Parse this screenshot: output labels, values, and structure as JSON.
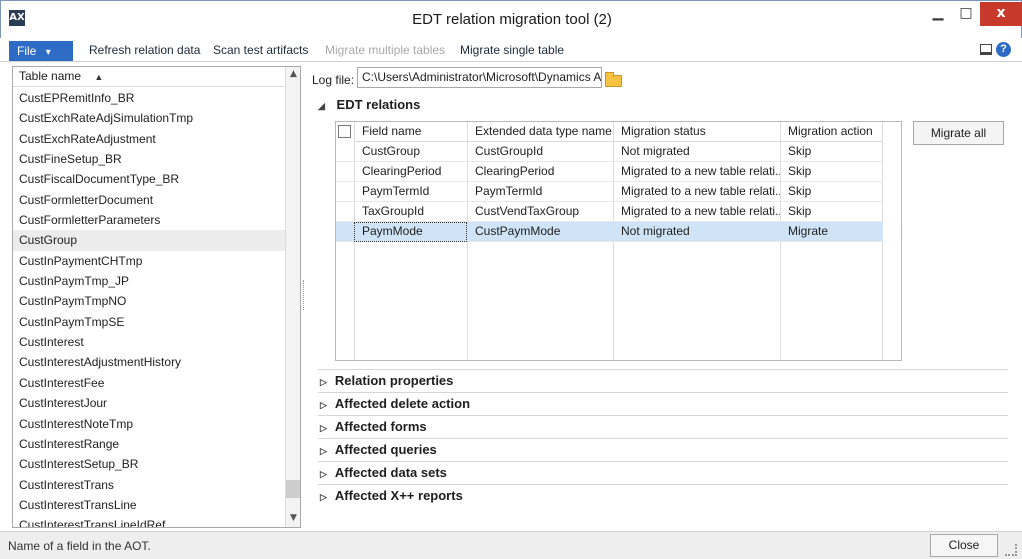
{
  "window": {
    "title": "EDT relation migration tool (2)",
    "app_icon": "window-app-icon",
    "min_glyph": "▁",
    "max_glyph": "□",
    "close_glyph": "x"
  },
  "actions": {
    "file": "File",
    "file_caret": "▾",
    "refresh": "Refresh relation data",
    "scan": "Scan test artifacts",
    "migrate_multiple": "Migrate multiple tables",
    "migrate_single": "Migrate single table",
    "help_glyph": "?"
  },
  "table_list": {
    "header": "Table name",
    "sort_glyph": "▲",
    "selected_index": 8,
    "items": [
      "CustEPRemitInfo_BR",
      "CustExchRateAdjSimulationTmp",
      "CustExchRateAdjustment",
      "CustFineSetup_BR",
      "CustFiscalDocumentType_BR",
      "CustFormletterDocument",
      "CustFormletterParameters",
      "CustGroup",
      "CustInPaymentCHTmp",
      "CustInPaymTmp_JP",
      "CustInPaymTmpNO",
      "CustInPaymTmpSE",
      "CustInterest",
      "CustInterestAdjustmentHistory",
      "CustInterestFee",
      "CustInterestJour",
      "CustInterestNoteTmp",
      "CustInterestRange",
      "CustInterestSetup_BR",
      "CustInterestTrans",
      "CustInterestTransLine",
      "CustInterestTransLineIdRef"
    ],
    "scroll_up": "▲",
    "scroll_down": "▼"
  },
  "log": {
    "label": "Log file:",
    "value": "C:\\Users\\Administrator\\Microsoft\\Dynamics A"
  },
  "edt": {
    "header": "EDT relations",
    "expand_glyph": "◢",
    "columns": [
      "Field name",
      "Extended data type name",
      "Migration status",
      "Migration action"
    ],
    "rows": [
      [
        "CustGroup",
        "CustGroupId",
        "Not migrated",
        "Skip"
      ],
      [
        "ClearingPeriod",
        "ClearingPeriod",
        "Migrated to a new table relati...",
        "Skip"
      ],
      [
        "PaymTermId",
        "PaymTermId",
        "Migrated to a new table relati...",
        "Skip"
      ],
      [
        "TaxGroupId",
        "CustVendTaxGroup",
        "Migrated to a new table relati...",
        "Skip"
      ],
      [
        "PaymMode",
        "CustPaymMode",
        "Not migrated",
        "Migrate"
      ]
    ],
    "selected_row": 4,
    "migrate_all": "Migrate all"
  },
  "sections": {
    "collapse_glyph": "▷",
    "items": [
      "Relation properties",
      "Affected delete action",
      "Affected forms",
      "Affected queries",
      "Affected data sets",
      "Affected X++ reports"
    ]
  },
  "status": {
    "text": "Name of a field in the AOT.",
    "close": "Close"
  },
  "colors": {
    "accent": "#2d6bc4",
    "close_red": "#c7392b",
    "selection": "#cfe4f7"
  }
}
